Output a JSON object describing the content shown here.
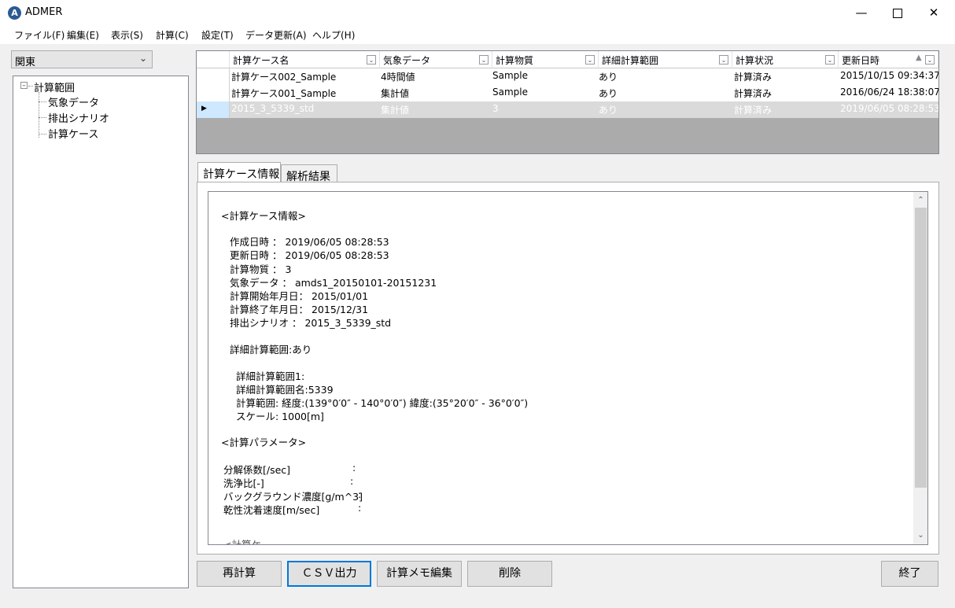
{
  "window": {
    "title": "ADMER",
    "icon": "A"
  },
  "menu": [
    "ファイル(F)",
    "編集(E)",
    "表示(S)",
    "計算(C)",
    "設定(T)",
    "データ更新(A)",
    "ヘルプ(H)"
  ],
  "region": {
    "selected": "関東"
  },
  "tree": {
    "root": "計算範囲",
    "children": [
      "気象データ",
      "排出シナリオ",
      "計算ケース"
    ]
  },
  "grid": {
    "columns": [
      "計算ケース名",
      "気象データ",
      "計算物質",
      "詳細計算範囲",
      "計算状況",
      "更新日時"
    ],
    "rows": [
      [
        "計算ケース002_Sample",
        "4時間値",
        "Sample",
        "あり",
        "計算済み",
        "2015/10/15 09:34:37"
      ],
      [
        "計算ケース001_Sample",
        "集計値",
        "Sample",
        "あり",
        "計算済み",
        "2016/06/24 18:38:07"
      ],
      [
        "2015_3_5339_std",
        "集計値",
        "3",
        "あり",
        "計算済み",
        "2019/06/05 08:28:53"
      ]
    ],
    "selected_row": 2
  },
  "tabs": [
    "計算ケース情報",
    "解析結果"
  ],
  "info": {
    "lines": [
      "<計算ケース情報>",
      "作成日時 ：  2019/06/05 08:28:53",
      "更新日時 ：  2019/06/05 08:28:53",
      "計算物質 ：  3",
      "気象データ ：  amds1_20150101-20151231",
      "計算開始年月日：  2015/01/01",
      "計算終了年月日：  2015/12/31",
      "排出シナリオ  ：  2015_3_5339_std",
      "詳細計算範囲:あり",
      "詳細計算範囲1:",
      "詳細計算範囲名:5339",
      "計算範囲: 経度:(139°0′0″ - 140°0′0″)  緯度:(35°20′0″ - 36°0′0″)",
      "スケール: 1000[m]",
      "<計算パラメータ>",
      "分解係数[/sec]",
      "洗浄比[-]",
      "バックグラウンド濃度[g/m^3]",
      "乾性沈着速度[m/sec]",
      ":",
      "<計算ケ..."
    ]
  },
  "buttons": {
    "recalc": "再計算",
    "csv": "ＣＳＶ出力",
    "memo": "計算メモ編集",
    "delete": "削除",
    "exit": "終了"
  }
}
